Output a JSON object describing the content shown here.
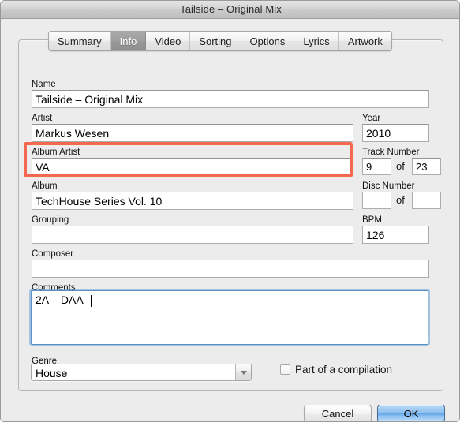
{
  "window": {
    "title": "Tailside – Original Mix"
  },
  "tabs": [
    {
      "label": "Summary",
      "selected": false
    },
    {
      "label": "Info",
      "selected": true
    },
    {
      "label": "Video",
      "selected": false
    },
    {
      "label": "Sorting",
      "selected": false
    },
    {
      "label": "Options",
      "selected": false
    },
    {
      "label": "Lyrics",
      "selected": false
    },
    {
      "label": "Artwork",
      "selected": false
    }
  ],
  "fields": {
    "name": {
      "label": "Name",
      "value": "Tailside – Original Mix"
    },
    "artist": {
      "label": "Artist",
      "value": "Markus Wesen"
    },
    "album_artist": {
      "label": "Album Artist",
      "value": "VA",
      "highlighted": true
    },
    "album": {
      "label": "Album",
      "value": "TechHouse Series Vol. 10"
    },
    "grouping": {
      "label": "Grouping",
      "value": ""
    },
    "composer": {
      "label": "Composer",
      "value": ""
    },
    "comments": {
      "label": "Comments",
      "value": "2A – DAA",
      "focused": true
    },
    "year": {
      "label": "Year",
      "value": "2010"
    },
    "track_number": {
      "label": "Track Number",
      "value": "9",
      "of_word": "of",
      "total": "23"
    },
    "disc_number": {
      "label": "Disc Number",
      "value": "",
      "of_word": "of",
      "total": ""
    },
    "bpm": {
      "label": "BPM",
      "value": "126"
    },
    "genre": {
      "label": "Genre",
      "value": "House"
    }
  },
  "compilation": {
    "label": "Part of a compilation",
    "checked": false
  },
  "buttons": {
    "cancel": "Cancel",
    "ok": "OK"
  },
  "colors": {
    "highlight": "#f4684f",
    "focus_ring": "#6a9fd6",
    "default_button": "#5ea4e8"
  },
  "icons": {
    "genre_dropdown": "chevron-down-icon"
  }
}
